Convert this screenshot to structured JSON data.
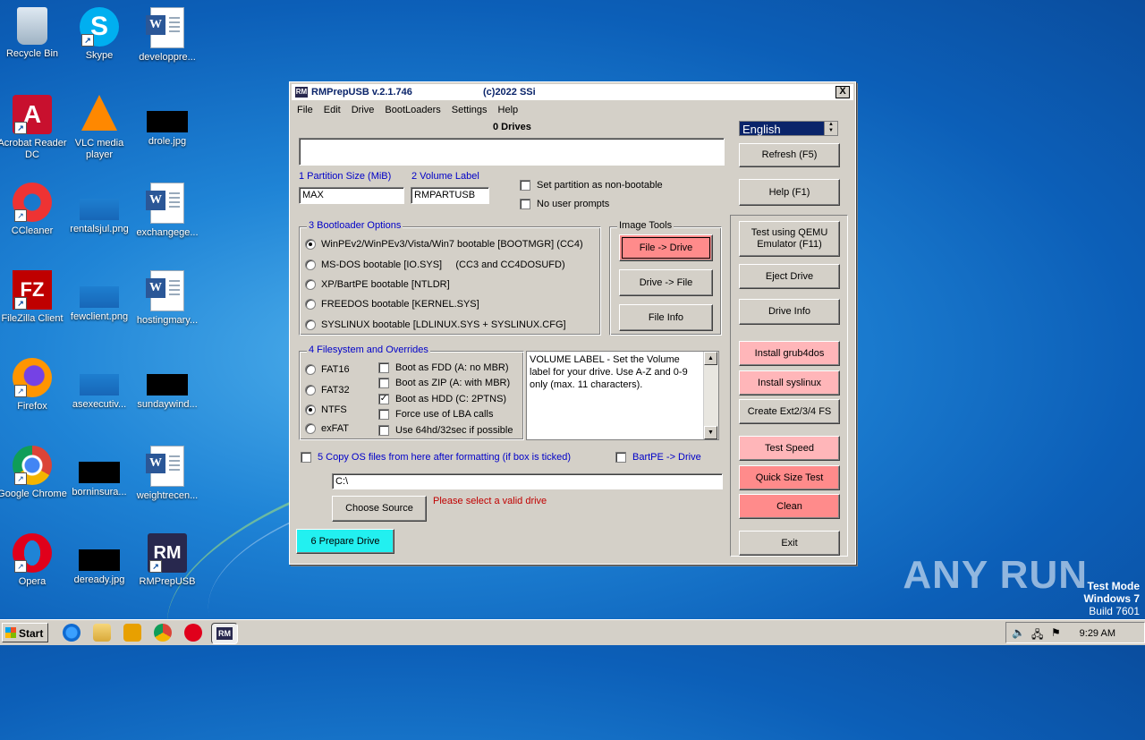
{
  "desktop": {
    "icons": [
      {
        "label": "Recycle Bin",
        "icon": "recycle-bin-icon"
      },
      {
        "label": "Skype",
        "icon": "skype-icon"
      },
      {
        "label": "developpre...",
        "icon": "word-doc-icon"
      },
      {
        "label": "Acrobat Reader DC",
        "icon": "acrobat-icon"
      },
      {
        "label": "VLC media player",
        "icon": "vlc-icon"
      },
      {
        "label": "drole.jpg",
        "icon": "image-file-icon"
      },
      {
        "label": "CCleaner",
        "icon": "ccleaner-icon"
      },
      {
        "label": "rentalsjul.png",
        "icon": "image-file-icon"
      },
      {
        "label": "exchangege...",
        "icon": "word-doc-icon"
      },
      {
        "label": "FileZilla Client",
        "icon": "filezilla-icon"
      },
      {
        "label": "fewclient.png",
        "icon": "image-file-icon"
      },
      {
        "label": "hostingmary...",
        "icon": "word-doc-icon"
      },
      {
        "label": "Firefox",
        "icon": "firefox-icon"
      },
      {
        "label": "asexecutiv...",
        "icon": "image-file-icon"
      },
      {
        "label": "sundaywind...",
        "icon": "image-file-icon"
      },
      {
        "label": "Google Chrome",
        "icon": "chrome-icon"
      },
      {
        "label": "borninsura...",
        "icon": "image-file-icon"
      },
      {
        "label": "weightrecen...",
        "icon": "word-doc-icon"
      },
      {
        "label": "Opera",
        "icon": "opera-icon"
      },
      {
        "label": "deready.jpg",
        "icon": "image-file-icon"
      },
      {
        "label": "RMPrepUSB",
        "icon": "rmprepusb-icon"
      }
    ],
    "watermark": "ANY RUN",
    "test_mode": [
      "Test Mode",
      "Windows 7",
      "Build 7601"
    ]
  },
  "window": {
    "title": "RMPrepUSB v.2.1.746",
    "copyright": "(c)2022 SSi",
    "logo": "RM",
    "close": "X",
    "menu": [
      "File",
      "Edit",
      "Drive",
      "BootLoaders",
      "Settings",
      "Help"
    ],
    "drives_label": "0 Drives",
    "partition_size_label": "1 Partition Size (MiB)",
    "partition_size_value": "MAX",
    "volume_label_label": "2 Volume Label",
    "volume_label_value": "RMPARTUSB",
    "opt_non_bootable": "Set partition as non-bootable",
    "opt_no_prompts": "No user prompts",
    "bootloader_title": "3 Bootloader Options",
    "bootloaders": [
      "WinPEv2/WinPEv3/Vista/Win7 bootable [BOOTMGR] (CC4)",
      "MS-DOS bootable [IO.SYS]     (CC3 and CC4DOSUFD)",
      "XP/BartPE bootable [NTLDR]",
      "FREEDOS bootable [KERNEL.SYS]",
      "SYSLINUX bootable [LDLINUX.SYS + SYSLINUX.CFG]"
    ],
    "image_tools_title": "Image Tools",
    "file_to_drive": "File -> Drive",
    "drive_to_file": "Drive -> File",
    "file_info": "File Info",
    "fs_title": "4 Filesystem and Overrides",
    "filesystems": [
      "FAT16",
      "FAT32",
      "NTFS",
      "exFAT"
    ],
    "overrides": [
      "Boot as FDD (A: no MBR)",
      "Boot as ZIP (A: with MBR)",
      "Boot as HDD (C: 2PTNS)",
      "Force use of LBA calls",
      "Use 64hd/32sec if possible"
    ],
    "help_text": "VOLUME LABEL - Set the Volume label for your drive. Use A-Z and 0-9 only (max. 11 characters).",
    "copy_os_label": "5 Copy OS files from here after formatting (if box is ticked)",
    "bartpe_label": "BartPE -> Drive",
    "source_path": "C:\\",
    "choose_source": "Choose Source",
    "status_message": "Please select a valid drive",
    "prepare_drive": "6 Prepare Drive",
    "language": "English",
    "refresh": "Refresh (F5)",
    "help": "Help (F1)",
    "test_qemu": "Test using QEMU Emulator (F11)",
    "eject": "Eject Drive",
    "drive_info": "Drive Info",
    "install_grub": "Install grub4dos",
    "install_syslinux": "Install syslinux",
    "create_ext": "Create Ext2/3/4 FS",
    "test_speed": "Test Speed",
    "quick_size": "Quick Size Test",
    "clean": "Clean",
    "exit": "Exit"
  },
  "taskbar": {
    "start": "Start",
    "time": "9:29 AM"
  }
}
